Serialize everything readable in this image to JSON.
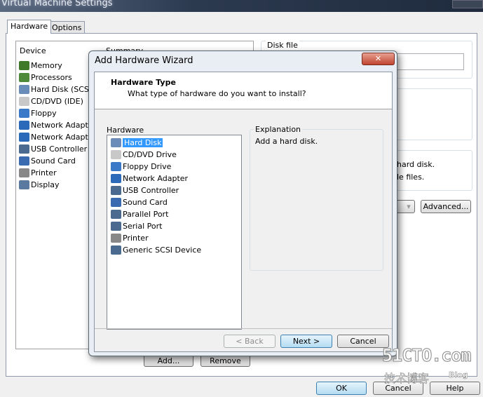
{
  "window": {
    "title": "Virtual Machine Settings"
  },
  "tabs": [
    {
      "label": "Hardware"
    },
    {
      "label": "Options"
    }
  ],
  "devices": {
    "header_device": "Device",
    "header_summary": "Summary",
    "items": [
      {
        "label": "Memory",
        "icon": "memory-icon"
      },
      {
        "label": "Processors",
        "icon": "processor-icon"
      },
      {
        "label": "Hard Disk (SCSI)",
        "icon": "hard-disk-icon"
      },
      {
        "label": "CD/DVD (IDE)",
        "icon": "cd-dvd-icon"
      },
      {
        "label": "Floppy",
        "icon": "floppy-icon"
      },
      {
        "label": "Network Adapter",
        "icon": "network-adapter-icon"
      },
      {
        "label": "Network Adapter",
        "icon": "network-adapter-icon"
      },
      {
        "label": "USB Controller",
        "icon": "usb-icon"
      },
      {
        "label": "Sound Card",
        "icon": "sound-card-icon"
      },
      {
        "label": "Printer",
        "icon": "printer-icon"
      },
      {
        "label": "Display",
        "icon": "display-icon"
      }
    ]
  },
  "right": {
    "disk_file_label": "Disk file",
    "info_line1": "hard disk.",
    "info_line2": "le files.",
    "advanced": "Advanced..."
  },
  "bottom": {
    "add": "Add...",
    "remove": "Remove",
    "ok": "OK",
    "cancel": "Cancel",
    "help": "Help"
  },
  "wizard": {
    "title": "Add Hardware Wizard",
    "heading": "Hardware Type",
    "subheading": "What type of hardware do you want to install?",
    "hardware_label": "Hardware",
    "explanation_label": "Explanation",
    "explanation": "Add a hard disk.",
    "items": [
      {
        "label": "Hard Disk",
        "icon": "hard-disk-icon",
        "selected": true
      },
      {
        "label": "CD/DVD Drive",
        "icon": "cd-dvd-icon"
      },
      {
        "label": "Floppy Drive",
        "icon": "floppy-icon"
      },
      {
        "label": "Network Adapter",
        "icon": "network-adapter-icon"
      },
      {
        "label": "USB Controller",
        "icon": "usb-icon"
      },
      {
        "label": "Sound Card",
        "icon": "sound-card-icon"
      },
      {
        "label": "Parallel Port",
        "icon": "parallel-port-icon"
      },
      {
        "label": "Serial Port",
        "icon": "serial-port-icon"
      },
      {
        "label": "Printer",
        "icon": "printer-icon"
      },
      {
        "label": "Generic SCSI Device",
        "icon": "scsi-device-icon"
      }
    ],
    "back": "< Back",
    "next": "Next >",
    "cancel": "Cancel"
  },
  "watermark": {
    "text": "51CTO.com",
    "sub": "技术博客",
    "blog": "Blog"
  },
  "icon_colors": {
    "memory-icon": "#3f7a2a",
    "processor-icon": "#4f8a3a",
    "hard-disk-icon": "#6a8cb8",
    "cd-dvd-icon": "#c8c8c8",
    "floppy-icon": "#3a78c8",
    "network-adapter-icon": "#2a6ab8",
    "usb-icon": "#4a6a90",
    "sound-card-icon": "#3a6ab0",
    "printer-icon": "#888888",
    "display-icon": "#5a7aa0",
    "parallel-port-icon": "#4a6a90",
    "serial-port-icon": "#4a6a90",
    "scsi-device-icon": "#4a6a90"
  }
}
